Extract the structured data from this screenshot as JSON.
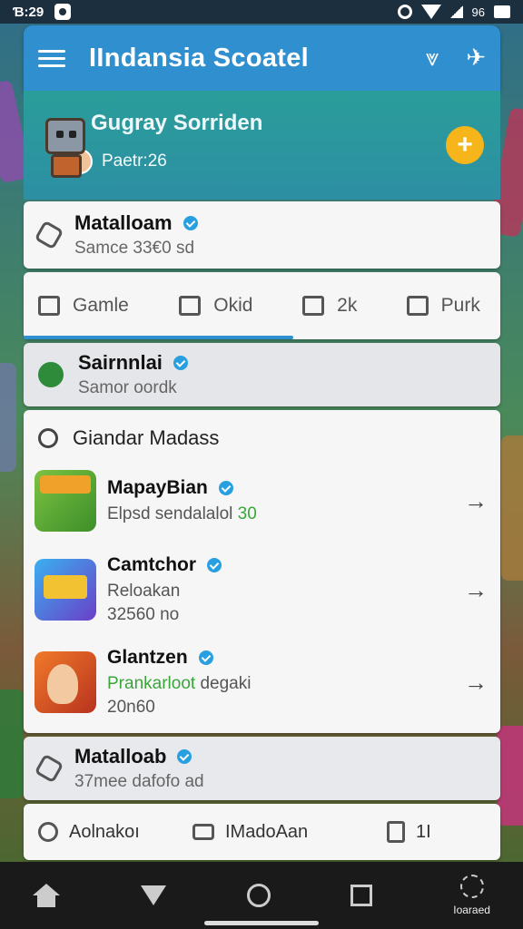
{
  "status_bar": {
    "time": "Ɓ:29",
    "network": "96"
  },
  "app_bar": {
    "title": "IIndansia Scoatel"
  },
  "banner": {
    "name": "Gugray Sorriden",
    "subtitle": "Paetr:26",
    "add_button": "+"
  },
  "card1": {
    "title": "Matalloam",
    "subtitle": "Samce 33€0 sd"
  },
  "tabs": [
    {
      "label": "Gamle"
    },
    {
      "label": "Okid"
    },
    {
      "label": "2k"
    },
    {
      "label": "Purk"
    }
  ],
  "card2": {
    "title": "Sairnnlai",
    "subtitle": "Samor oordk"
  },
  "list": {
    "header": "Giandar Madass",
    "items": [
      {
        "title": "MapayBian",
        "sub": "Elpsd sendalalol",
        "sub_accent": "30",
        "meta": ""
      },
      {
        "title": "Camtchor",
        "sub": "Reloakan",
        "sub_accent": "",
        "meta": "32560 no"
      },
      {
        "title": "Glantzen",
        "sub": "",
        "sub_accent": "Prankarloot",
        "sub_tail": " degaki",
        "meta": "20n60"
      }
    ],
    "arrow": "→"
  },
  "card3": {
    "title": "Matalloab",
    "subtitle": "37mee dafofo ad"
  },
  "bottom_row": [
    {
      "label": "Aolnakoı"
    },
    {
      "label": "IMadoAan"
    },
    {
      "label": "1Ι"
    }
  ],
  "nav": {
    "extra_label": "Ioaraed"
  }
}
